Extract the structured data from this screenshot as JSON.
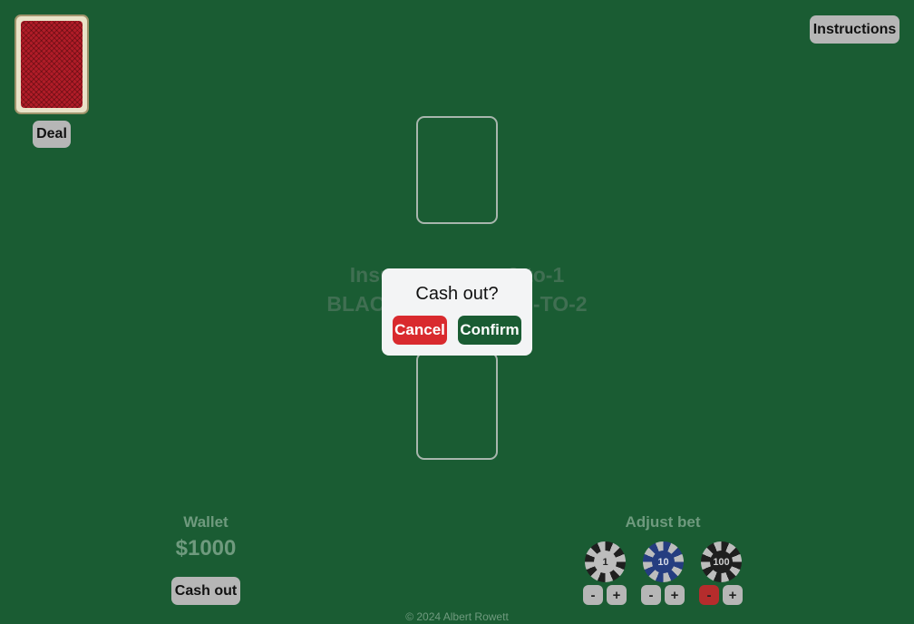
{
  "header": {
    "instructions_label": "Instructions"
  },
  "deck": {
    "deal_label": "Deal"
  },
  "table": {
    "line1": "Insurance pays 2-to-1",
    "line2": "BLACKJACK PAYS 3-TO-2"
  },
  "modal": {
    "title": "Cash out?",
    "cancel_label": "Cancel",
    "confirm_label": "Confirm"
  },
  "wallet": {
    "label": "Wallet",
    "amount": "$1000",
    "cashout_label": "Cash out"
  },
  "bet": {
    "label": "Adjust bet",
    "chips": [
      {
        "value": "1",
        "minus": "-",
        "plus": "+"
      },
      {
        "value": "10",
        "minus": "-",
        "plus": "+"
      },
      {
        "value": "100",
        "minus": "-",
        "plus": "+"
      }
    ]
  },
  "footer": {
    "copyright": "© 2024 Albert Rowett"
  },
  "colors": {
    "felt": "#1a5c33",
    "cancel": "#d92a2e",
    "confirm": "#1a5c33",
    "chip_blue": "#253d80",
    "minus_active": "#b52c2c"
  }
}
